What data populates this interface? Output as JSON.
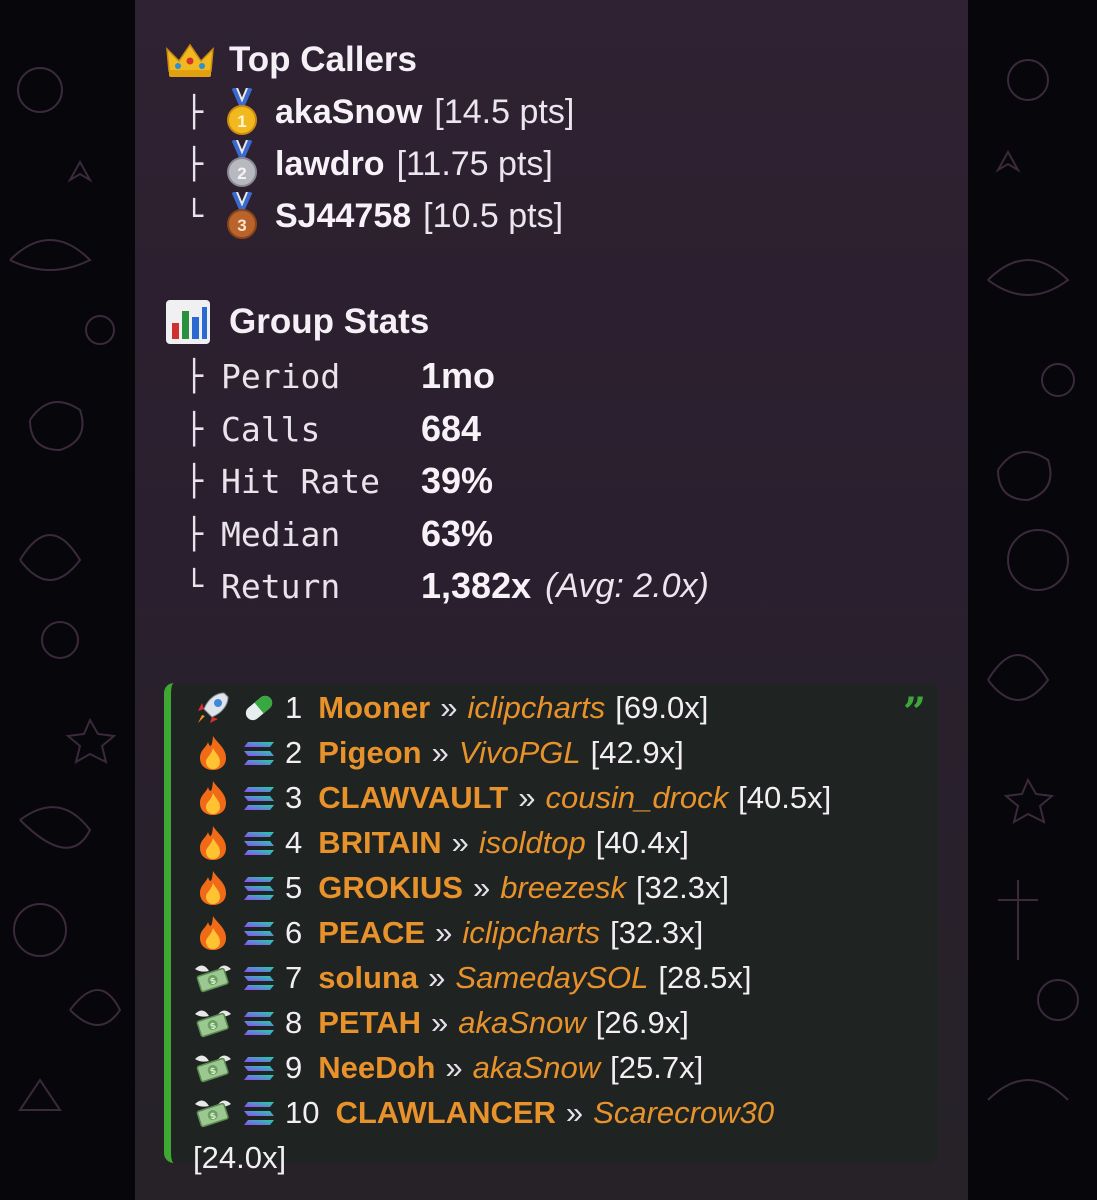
{
  "top_callers": {
    "icon": "crown-icon",
    "title": "Top Callers",
    "callers": [
      {
        "tree": "├",
        "medal": "gold-medal-icon",
        "medal_number": "1",
        "name": "akaSnow",
        "points": "[14.5 pts]"
      },
      {
        "tree": "├",
        "medal": "silver-medal-icon",
        "medal_number": "2",
        "name": "lawdro",
        "points": "[11.75 pts]"
      },
      {
        "tree": "└",
        "medal": "bronze-medal-icon",
        "medal_number": "3",
        "name": "SJ44758",
        "points": "[10.5 pts]"
      }
    ]
  },
  "group_stats": {
    "icon": "bar-chart-icon",
    "title": "Group Stats",
    "rows": [
      {
        "tree": "├",
        "label": "Period",
        "value": "1mo"
      },
      {
        "tree": "├",
        "label": "Calls",
        "value": "684"
      },
      {
        "tree": "├",
        "label": "Hit Rate",
        "value": "39%"
      },
      {
        "tree": "├",
        "label": "Median",
        "value": "63%"
      },
      {
        "tree": "└",
        "label": "Return",
        "value": "1,382x",
        "extra": "(Avg: 2.0x)"
      }
    ]
  },
  "leaderboard": {
    "separator": "»",
    "wrapped_multiplier": "[24.0x]",
    "colors": {
      "accent_bar": "#3da832",
      "token": "#e8922b"
    },
    "rows": [
      {
        "icon1": "rocket-icon",
        "icon2": "pill-icon",
        "rank": "1",
        "token": "Mooner",
        "caller": "iclipcharts",
        "multiplier": "[69.0x]"
      },
      {
        "icon1": "fire-icon",
        "icon2": "solana-icon",
        "rank": "2",
        "token": "Pigeon",
        "caller": "VivoPGL",
        "multiplier": "[42.9x]"
      },
      {
        "icon1": "fire-icon",
        "icon2": "solana-icon",
        "rank": "3",
        "token": "CLAWVAULT",
        "caller": "cousin_drock",
        "multiplier": "[40.5x]"
      },
      {
        "icon1": "fire-icon",
        "icon2": "solana-icon",
        "rank": "4",
        "token": "BRITAIN",
        "caller": "isoldtop",
        "multiplier": "[40.4x]"
      },
      {
        "icon1": "fire-icon",
        "icon2": "solana-icon",
        "rank": "5",
        "token": "GROKIUS",
        "caller": "breezesk",
        "multiplier": "[32.3x]"
      },
      {
        "icon1": "fire-icon",
        "icon2": "solana-icon",
        "rank": "6",
        "token": "PEACE",
        "caller": "iclipcharts",
        "multiplier": "[32.3x]"
      },
      {
        "icon1": "money-wings-icon",
        "icon2": "solana-icon",
        "rank": "7",
        "token": "soluna",
        "caller": "SamedaySOL",
        "multiplier": "[28.5x]"
      },
      {
        "icon1": "money-wings-icon",
        "icon2": "solana-icon",
        "rank": "8",
        "token": "PETAH",
        "caller": "akaSnow",
        "multiplier": "[26.9x]"
      },
      {
        "icon1": "money-wings-icon",
        "icon2": "solana-icon",
        "rank": "9",
        "token": "NeeDoh",
        "caller": "akaSnow",
        "multiplier": "[25.7x]"
      },
      {
        "icon1": "money-wings-icon",
        "icon2": "solana-icon",
        "rank": "10",
        "token": "CLAWLANCER",
        "caller": "Scarecrow30",
        "multiplier": ""
      }
    ]
  }
}
